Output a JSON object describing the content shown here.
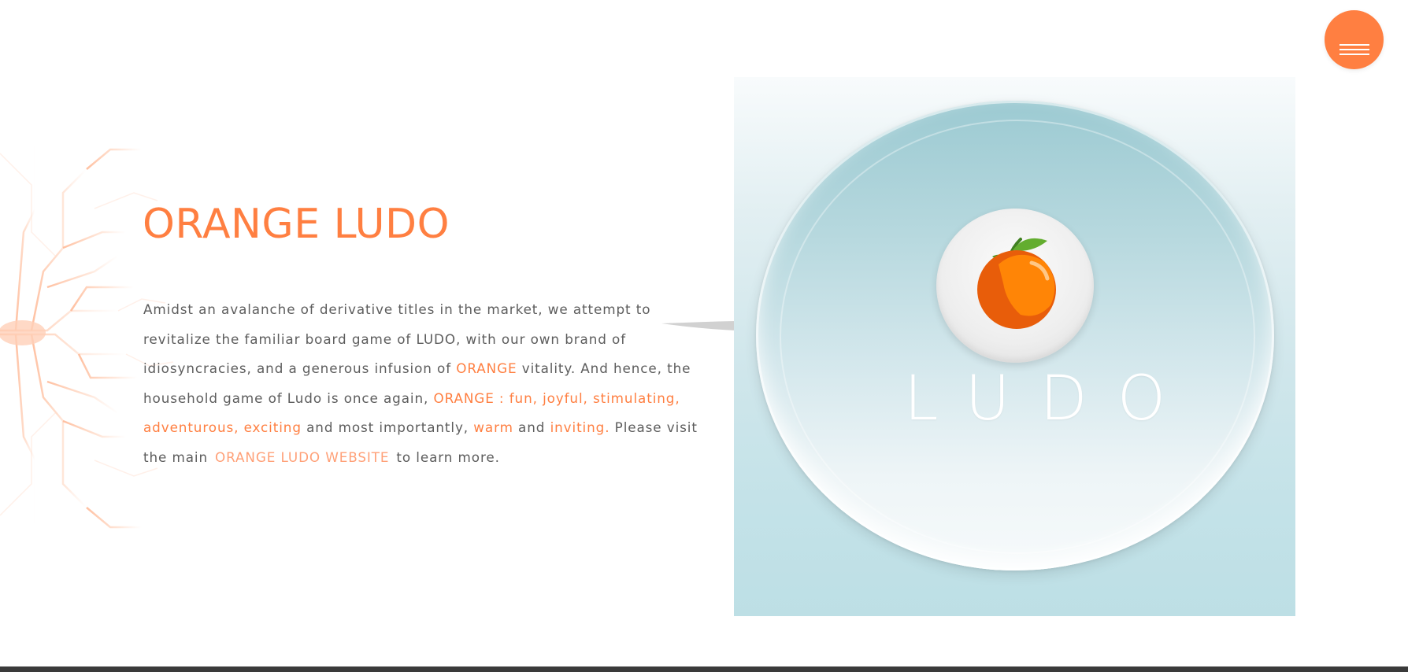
{
  "colors": {
    "accent": "#ff7f41",
    "link": "#ffa077",
    "body_text": "#5d5d5d",
    "panel": "#c3e2e8"
  },
  "menu": {
    "icon": "hamburger-menu-icon"
  },
  "hero": {
    "title": "ORANGE LUDO",
    "description": {
      "p1": "Amidst an avalanche of derivative titles in the market, we attempt to revitalize the familiar board game of LUDO, with our own brand of idiosyncracies, and a generous infusion of ",
      "hl1": "ORANGE",
      "p2": " vitality. And hence, the household game of Ludo is once again, ",
      "hl2": "ORANGE : fun, joyful, stimulating, adventurous, exciting",
      "p3": " and most importantly, ",
      "hl3": "warm",
      "p4": " and ",
      "hl4": "inviting.",
      "p5": " Please visit the main",
      "link": "ORANGE LUDO WEBSITE",
      "p6": "to learn more."
    }
  },
  "logo": {
    "icon": "orange-fruit-icon",
    "wordmark": "LUDO"
  }
}
